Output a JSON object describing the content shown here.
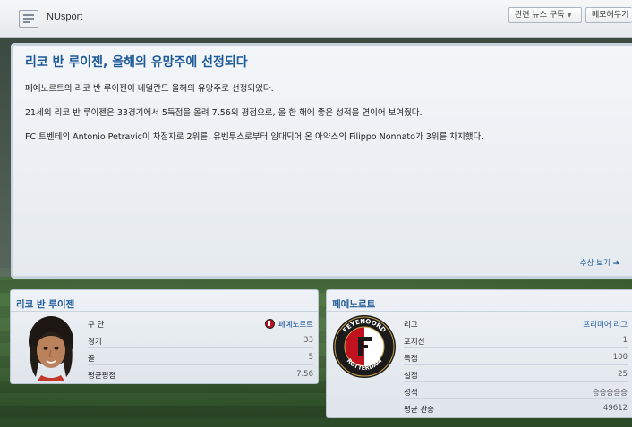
{
  "topbar": {
    "title": "NUsport",
    "subscribe_label": "관련 뉴스 구독",
    "memo_label": "메모해두기"
  },
  "article": {
    "headline": "리코 반 루이젠, 올해의 유망주에 선정되다",
    "paragraphs": [
      "페예노르트의 리코 반 루이젠이 네덜란드 올해의 유망주로 선정되었다.",
      "21세의 리코 반 루이젠은 33경기에서 5득점을 올려 7.56의 평점으로, 올 한 해에 좋은 성적을 연이어 보여줬다.",
      "FC 트벤테의 Antonio Petravic이 차점자로 2위를, 유벤투스로부터 임대되어 온 아약스의 Filippo Nonnato가 3위를 차지했다."
    ],
    "awards_link": "수상 보기"
  },
  "player_card": {
    "title": "리코 반 루이젠",
    "rows": [
      {
        "label": "구 단",
        "value": "페예노르트"
      },
      {
        "label": "경기",
        "value": "33"
      },
      {
        "label": "골",
        "value": "5"
      },
      {
        "label": "평균평점",
        "value": "7.56"
      }
    ]
  },
  "club_card": {
    "title": "페예노르트",
    "badge_text": "FEYENOORD ROTTERDAM",
    "rows": [
      {
        "label": "리그",
        "value": "프리미어 리그"
      },
      {
        "label": "포지션",
        "value": "1"
      },
      {
        "label": "득점",
        "value": "100"
      },
      {
        "label": "실점",
        "value": "25"
      },
      {
        "label": "성적",
        "value": "승승승승승"
      },
      {
        "label": "평균 관중",
        "value": "49612"
      }
    ]
  },
  "colors": {
    "accent": "#1f5a98",
    "club_red": "#c1121f"
  }
}
